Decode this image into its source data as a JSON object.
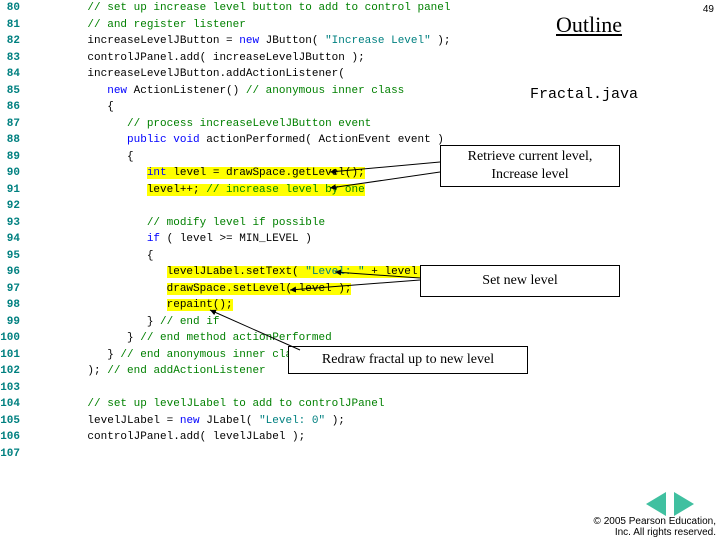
{
  "pagenum": "49",
  "outline": "Outline",
  "filename": "Fractal.java",
  "callout1a": "Retrieve current level,",
  "callout1b": "Increase level",
  "callout2": "Set new level",
  "callout3": "Redraw fractal up to new level",
  "copyright1": "© 2005 Pearson Education,",
  "copyright2": "Inc.  All rights reserved.",
  "lines": [
    {
      "n": "80",
      "indent": 3,
      "tokens": [
        {
          "t": "// set up increase level button to add to control panel",
          "c": "c-comment"
        }
      ]
    },
    {
      "n": "81",
      "indent": 3,
      "tokens": [
        {
          "t": "// and register listener",
          "c": "c-comment"
        }
      ]
    },
    {
      "n": "82",
      "indent": 3,
      "tokens": [
        {
          "t": "increaseLevelJButton = ",
          "c": "c-plain"
        },
        {
          "t": "new",
          "c": "c-kw"
        },
        {
          "t": " JButton( ",
          "c": "c-plain"
        },
        {
          "t": "\"Increase Level\"",
          "c": "c-str"
        },
        {
          "t": " );",
          "c": "c-plain"
        }
      ]
    },
    {
      "n": "83",
      "indent": 3,
      "tokens": [
        {
          "t": "controlJPanel.add( increaseLevelJButton );",
          "c": "c-plain"
        }
      ]
    },
    {
      "n": "84",
      "indent": 3,
      "tokens": [
        {
          "t": "increaseLevelJButton.addActionListener(",
          "c": "c-plain"
        }
      ]
    },
    {
      "n": "85",
      "indent": 4,
      "tokens": [
        {
          "t": "new",
          "c": "c-kw"
        },
        {
          "t": " ActionListener() ",
          "c": "c-plain"
        },
        {
          "t": "// anonymous inner class",
          "c": "c-comment"
        }
      ]
    },
    {
      "n": "86",
      "indent": 4,
      "tokens": [
        {
          "t": "{",
          "c": "c-plain"
        }
      ]
    },
    {
      "n": "87",
      "indent": 5,
      "tokens": [
        {
          "t": "// process increaseLevelJButton event",
          "c": "c-comment"
        }
      ]
    },
    {
      "n": "88",
      "indent": 5,
      "tokens": [
        {
          "t": "public",
          "c": "c-kw"
        },
        {
          "t": " ",
          "c": "c-plain"
        },
        {
          "t": "void",
          "c": "c-kw"
        },
        {
          "t": " actionPerformed( ActionEvent event )",
          "c": "c-plain"
        }
      ]
    },
    {
      "n": "89",
      "indent": 5,
      "tokens": [
        {
          "t": "{",
          "c": "c-plain"
        }
      ]
    },
    {
      "n": "90",
      "indent": 6,
      "tokens": [
        {
          "t": "int",
          "c": "c-kw hl"
        },
        {
          "t": " level = drawSpace.getLevel();",
          "c": "c-plain hl"
        }
      ]
    },
    {
      "n": "91",
      "indent": 6,
      "tokens": [
        {
          "t": "level++; ",
          "c": "c-plain hl"
        },
        {
          "t": "// increase level by one",
          "c": "c-comment hl"
        }
      ]
    },
    {
      "n": "92",
      "indent": 0,
      "tokens": []
    },
    {
      "n": "93",
      "indent": 6,
      "tokens": [
        {
          "t": "// modify level if possible",
          "c": "c-comment"
        }
      ]
    },
    {
      "n": "94",
      "indent": 6,
      "tokens": [
        {
          "t": "if",
          "c": "c-kw"
        },
        {
          "t": " ( level >= MIN_LEVEL )",
          "c": "c-plain"
        }
      ]
    },
    {
      "n": "95",
      "indent": 6,
      "tokens": [
        {
          "t": "{",
          "c": "c-plain"
        }
      ]
    },
    {
      "n": "96",
      "indent": 7,
      "tokens": [
        {
          "t": "levelJLabel.setText( ",
          "c": "c-plain hl"
        },
        {
          "t": "\"Level: \"",
          "c": "c-str hl"
        },
        {
          "t": " + level );",
          "c": "c-plain hl"
        }
      ]
    },
    {
      "n": "97",
      "indent": 7,
      "tokens": [
        {
          "t": "drawSpace.setLevel( level );",
          "c": "c-plain hl"
        }
      ]
    },
    {
      "n": "98",
      "indent": 7,
      "tokens": [
        {
          "t": "repaint();",
          "c": "c-plain hl"
        }
      ]
    },
    {
      "n": "99",
      "indent": 6,
      "tokens": [
        {
          "t": "} ",
          "c": "c-plain"
        },
        {
          "t": "// end if",
          "c": "c-comment"
        }
      ]
    },
    {
      "n": "100",
      "indent": 5,
      "tokens": [
        {
          "t": "} ",
          "c": "c-plain"
        },
        {
          "t": "// end method actionPerformed",
          "c": "c-comment"
        }
      ]
    },
    {
      "n": "101",
      "indent": 4,
      "tokens": [
        {
          "t": "} ",
          "c": "c-plain"
        },
        {
          "t": "// end anonymous inner class",
          "c": "c-comment"
        }
      ]
    },
    {
      "n": "102",
      "indent": 3,
      "tokens": [
        {
          "t": "); ",
          "c": "c-plain"
        },
        {
          "t": "// end addActionListener",
          "c": "c-comment"
        }
      ]
    },
    {
      "n": "103",
      "indent": 0,
      "tokens": []
    },
    {
      "n": "104",
      "indent": 3,
      "tokens": [
        {
          "t": "// set up levelJLabel to add to controlJPanel",
          "c": "c-comment"
        }
      ]
    },
    {
      "n": "105",
      "indent": 3,
      "tokens": [
        {
          "t": "levelJLabel = ",
          "c": "c-plain"
        },
        {
          "t": "new",
          "c": "c-kw"
        },
        {
          "t": " JLabel( ",
          "c": "c-plain"
        },
        {
          "t": "\"Level: 0\"",
          "c": "c-str"
        },
        {
          "t": " );",
          "c": "c-plain"
        }
      ]
    },
    {
      "n": "106",
      "indent": 3,
      "tokens": [
        {
          "t": "controlJPanel.add( levelJLabel );",
          "c": "c-plain"
        }
      ]
    },
    {
      "n": "107",
      "indent": 0,
      "tokens": []
    }
  ]
}
